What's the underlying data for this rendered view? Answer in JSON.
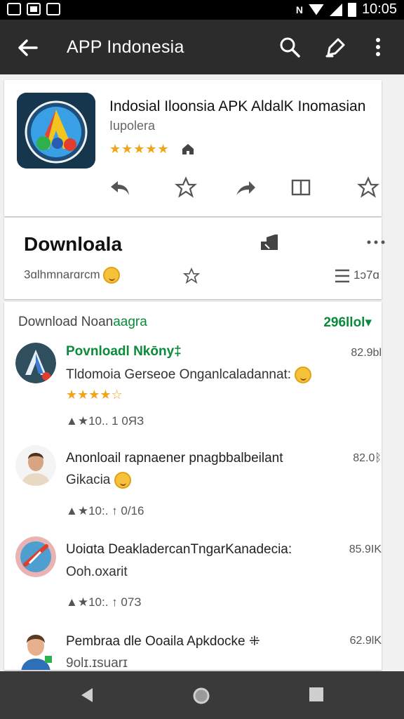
{
  "status_bar": {
    "time": "10:05",
    "icons": [
      "image-icon",
      "message-icon",
      "photo-icon",
      "nfc-icon",
      "wifi-icon",
      "signal-icon",
      "battery-icon"
    ],
    "nfc_label": "N"
  },
  "toolbar": {
    "title": "APP Indonesia",
    "icons": [
      "back-arrow-icon",
      "search-icon",
      "tag-icon",
      "more-vert-icon"
    ]
  },
  "app": {
    "name": "Indosial Iloonsia APK AldalK Inomasian",
    "subtitle": "Iupolera",
    "stars": "★★★★★",
    "actions": [
      "reply-icon",
      "star-outline-icon",
      "share-icon",
      "book-icon",
      "star-icon"
    ]
  },
  "download": {
    "title": "Downloala",
    "subtitle": "3ɑlhmnarɑrcm",
    "icons": [
      "download-bag-icon",
      "more-horiz-icon",
      "star-outline-icon",
      "list-icon"
    ],
    "side_count": "1ɔ7ɑ"
  },
  "list": {
    "header_prefix": "Download Noan",
    "header_green": "aagra",
    "count": "296llol▾",
    "items": [
      {
        "name": "Povnloadl Nkōny‡",
        "desc": "Tldomoia Gerseoe Onganlcaladannat:",
        "size": "82.9bl",
        "stars": "★★★★☆",
        "meta": "▲★10..  1 0ЯЗ",
        "name_green": true
      },
      {
        "name": "Anonloail rapnaener pnagbbalbeilant",
        "desc": "Gikacia",
        "size": "82.0ᛒ",
        "stars": "",
        "meta": "▲★10:.  ↑ 0/16",
        "name_green": false
      },
      {
        "name": "Uoiɑta DeakladercanTngarKanadecia:",
        "desc": "Ooh.oxarit",
        "size": "85.9IK",
        "stars": "",
        "meta": "▲★10:.  ↑ 07З",
        "name_green": false
      },
      {
        "name": "Pembraa dle Ooaila Apkdocke ⁜",
        "desc": "9olɪ.ɪsuarɪ",
        "size": "62.9lK",
        "stars": "",
        "meta": "",
        "name_green": false
      }
    ]
  },
  "nav": {
    "icons": [
      "back-triangle-icon",
      "home-circle-icon",
      "recents-square-icon"
    ]
  },
  "colors": {
    "accent_green": "#0a8a3a",
    "star_orange": "#f2a31b",
    "toolbar_bg": "#2c2c2c"
  }
}
